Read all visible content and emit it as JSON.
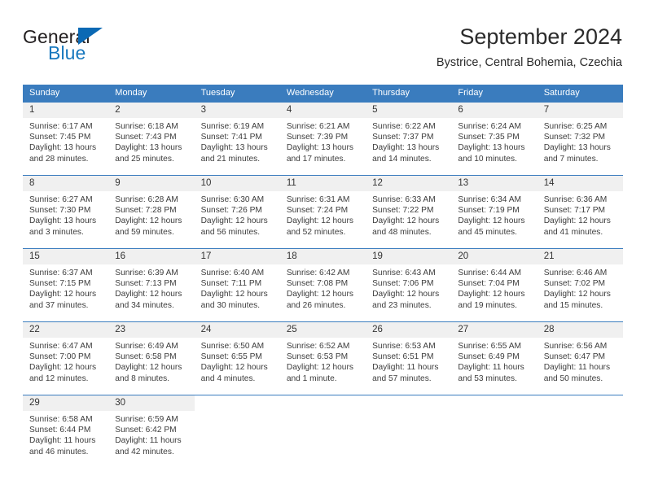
{
  "brand": {
    "name_part1": "General",
    "name_part2": "Blue",
    "flag_icon": "triangle-flag-icon",
    "accent_color": "#0b69b4",
    "text_color": "#1878be"
  },
  "header": {
    "title": "September 2024",
    "subtitle": "Bystrice, Central Bohemia, Czechia"
  },
  "calendar": {
    "header_background": "#3a7cbe",
    "date_bar_background": "#f0f0f0",
    "weekdays": [
      "Sunday",
      "Monday",
      "Tuesday",
      "Wednesday",
      "Thursday",
      "Friday",
      "Saturday"
    ],
    "weeks": [
      [
        {
          "date": "1",
          "sunrise": "Sunrise: 6:17 AM",
          "sunset": "Sunset: 7:45 PM",
          "daylight_line1": "Daylight: 13 hours",
          "daylight_line2": "and 28 minutes."
        },
        {
          "date": "2",
          "sunrise": "Sunrise: 6:18 AM",
          "sunset": "Sunset: 7:43 PM",
          "daylight_line1": "Daylight: 13 hours",
          "daylight_line2": "and 25 minutes."
        },
        {
          "date": "3",
          "sunrise": "Sunrise: 6:19 AM",
          "sunset": "Sunset: 7:41 PM",
          "daylight_line1": "Daylight: 13 hours",
          "daylight_line2": "and 21 minutes."
        },
        {
          "date": "4",
          "sunrise": "Sunrise: 6:21 AM",
          "sunset": "Sunset: 7:39 PM",
          "daylight_line1": "Daylight: 13 hours",
          "daylight_line2": "and 17 minutes."
        },
        {
          "date": "5",
          "sunrise": "Sunrise: 6:22 AM",
          "sunset": "Sunset: 7:37 PM",
          "daylight_line1": "Daylight: 13 hours",
          "daylight_line2": "and 14 minutes."
        },
        {
          "date": "6",
          "sunrise": "Sunrise: 6:24 AM",
          "sunset": "Sunset: 7:35 PM",
          "daylight_line1": "Daylight: 13 hours",
          "daylight_line2": "and 10 minutes."
        },
        {
          "date": "7",
          "sunrise": "Sunrise: 6:25 AM",
          "sunset": "Sunset: 7:32 PM",
          "daylight_line1": "Daylight: 13 hours",
          "daylight_line2": "and 7 minutes."
        }
      ],
      [
        {
          "date": "8",
          "sunrise": "Sunrise: 6:27 AM",
          "sunset": "Sunset: 7:30 PM",
          "daylight_line1": "Daylight: 13 hours",
          "daylight_line2": "and 3 minutes."
        },
        {
          "date": "9",
          "sunrise": "Sunrise: 6:28 AM",
          "sunset": "Sunset: 7:28 PM",
          "daylight_line1": "Daylight: 12 hours",
          "daylight_line2": "and 59 minutes."
        },
        {
          "date": "10",
          "sunrise": "Sunrise: 6:30 AM",
          "sunset": "Sunset: 7:26 PM",
          "daylight_line1": "Daylight: 12 hours",
          "daylight_line2": "and 56 minutes."
        },
        {
          "date": "11",
          "sunrise": "Sunrise: 6:31 AM",
          "sunset": "Sunset: 7:24 PM",
          "daylight_line1": "Daylight: 12 hours",
          "daylight_line2": "and 52 minutes."
        },
        {
          "date": "12",
          "sunrise": "Sunrise: 6:33 AM",
          "sunset": "Sunset: 7:22 PM",
          "daylight_line1": "Daylight: 12 hours",
          "daylight_line2": "and 48 minutes."
        },
        {
          "date": "13",
          "sunrise": "Sunrise: 6:34 AM",
          "sunset": "Sunset: 7:19 PM",
          "daylight_line1": "Daylight: 12 hours",
          "daylight_line2": "and 45 minutes."
        },
        {
          "date": "14",
          "sunrise": "Sunrise: 6:36 AM",
          "sunset": "Sunset: 7:17 PM",
          "daylight_line1": "Daylight: 12 hours",
          "daylight_line2": "and 41 minutes."
        }
      ],
      [
        {
          "date": "15",
          "sunrise": "Sunrise: 6:37 AM",
          "sunset": "Sunset: 7:15 PM",
          "daylight_line1": "Daylight: 12 hours",
          "daylight_line2": "and 37 minutes."
        },
        {
          "date": "16",
          "sunrise": "Sunrise: 6:39 AM",
          "sunset": "Sunset: 7:13 PM",
          "daylight_line1": "Daylight: 12 hours",
          "daylight_line2": "and 34 minutes."
        },
        {
          "date": "17",
          "sunrise": "Sunrise: 6:40 AM",
          "sunset": "Sunset: 7:11 PM",
          "daylight_line1": "Daylight: 12 hours",
          "daylight_line2": "and 30 minutes."
        },
        {
          "date": "18",
          "sunrise": "Sunrise: 6:42 AM",
          "sunset": "Sunset: 7:08 PM",
          "daylight_line1": "Daylight: 12 hours",
          "daylight_line2": "and 26 minutes."
        },
        {
          "date": "19",
          "sunrise": "Sunrise: 6:43 AM",
          "sunset": "Sunset: 7:06 PM",
          "daylight_line1": "Daylight: 12 hours",
          "daylight_line2": "and 23 minutes."
        },
        {
          "date": "20",
          "sunrise": "Sunrise: 6:44 AM",
          "sunset": "Sunset: 7:04 PM",
          "daylight_line1": "Daylight: 12 hours",
          "daylight_line2": "and 19 minutes."
        },
        {
          "date": "21",
          "sunrise": "Sunrise: 6:46 AM",
          "sunset": "Sunset: 7:02 PM",
          "daylight_line1": "Daylight: 12 hours",
          "daylight_line2": "and 15 minutes."
        }
      ],
      [
        {
          "date": "22",
          "sunrise": "Sunrise: 6:47 AM",
          "sunset": "Sunset: 7:00 PM",
          "daylight_line1": "Daylight: 12 hours",
          "daylight_line2": "and 12 minutes."
        },
        {
          "date": "23",
          "sunrise": "Sunrise: 6:49 AM",
          "sunset": "Sunset: 6:58 PM",
          "daylight_line1": "Daylight: 12 hours",
          "daylight_line2": "and 8 minutes."
        },
        {
          "date": "24",
          "sunrise": "Sunrise: 6:50 AM",
          "sunset": "Sunset: 6:55 PM",
          "daylight_line1": "Daylight: 12 hours",
          "daylight_line2": "and 4 minutes."
        },
        {
          "date": "25",
          "sunrise": "Sunrise: 6:52 AM",
          "sunset": "Sunset: 6:53 PM",
          "daylight_line1": "Daylight: 12 hours",
          "daylight_line2": "and 1 minute."
        },
        {
          "date": "26",
          "sunrise": "Sunrise: 6:53 AM",
          "sunset": "Sunset: 6:51 PM",
          "daylight_line1": "Daylight: 11 hours",
          "daylight_line2": "and 57 minutes."
        },
        {
          "date": "27",
          "sunrise": "Sunrise: 6:55 AM",
          "sunset": "Sunset: 6:49 PM",
          "daylight_line1": "Daylight: 11 hours",
          "daylight_line2": "and 53 minutes."
        },
        {
          "date": "28",
          "sunrise": "Sunrise: 6:56 AM",
          "sunset": "Sunset: 6:47 PM",
          "daylight_line1": "Daylight: 11 hours",
          "daylight_line2": "and 50 minutes."
        }
      ],
      [
        {
          "date": "29",
          "sunrise": "Sunrise: 6:58 AM",
          "sunset": "Sunset: 6:44 PM",
          "daylight_line1": "Daylight: 11 hours",
          "daylight_line2": "and 46 minutes."
        },
        {
          "date": "30",
          "sunrise": "Sunrise: 6:59 AM",
          "sunset": "Sunset: 6:42 PM",
          "daylight_line1": "Daylight: 11 hours",
          "daylight_line2": "and 42 minutes."
        },
        {
          "date": "",
          "sunrise": "",
          "sunset": "",
          "daylight_line1": "",
          "daylight_line2": ""
        },
        {
          "date": "",
          "sunrise": "",
          "sunset": "",
          "daylight_line1": "",
          "daylight_line2": ""
        },
        {
          "date": "",
          "sunrise": "",
          "sunset": "",
          "daylight_line1": "",
          "daylight_line2": ""
        },
        {
          "date": "",
          "sunrise": "",
          "sunset": "",
          "daylight_line1": "",
          "daylight_line2": ""
        },
        {
          "date": "",
          "sunrise": "",
          "sunset": "",
          "daylight_line1": "",
          "daylight_line2": ""
        }
      ]
    ]
  }
}
